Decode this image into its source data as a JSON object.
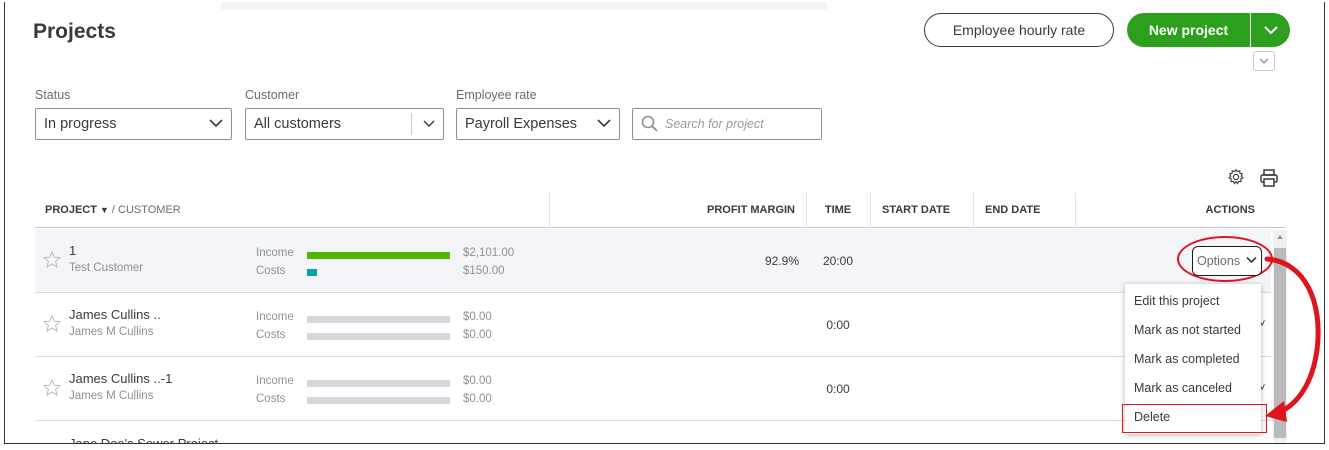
{
  "header": {
    "title": "Projects",
    "employee_rate_button": "Employee hourly rate",
    "new_project_button": "New project"
  },
  "filters": {
    "status": {
      "label": "Status",
      "value": "In progress"
    },
    "customer": {
      "label": "Customer",
      "value": "All customers"
    },
    "employee_rate": {
      "label": "Employee rate",
      "value": "Payroll Expenses"
    },
    "search": {
      "placeholder": "Search for project"
    }
  },
  "table": {
    "columns": {
      "project": "PROJECT",
      "customer": "/ CUSTOMER",
      "profit_margin": "PROFIT MARGIN",
      "time": "TIME",
      "start_date": "START DATE",
      "end_date": "END DATE",
      "actions": "ACTIONS"
    },
    "rows": [
      {
        "name": "1",
        "customer": "Test Customer",
        "income_label": "Income",
        "income": "$2,101.00",
        "income_fill": 1.0,
        "costs_label": "Costs",
        "costs": "$150.00",
        "costs_fill": 0.071,
        "profit_margin": "92.9%",
        "time": "20:00"
      },
      {
        "name": "James Cullins ..",
        "customer": "James M Cullins",
        "income_label": "Income",
        "income": "$0.00",
        "income_fill": 0,
        "costs_label": "Costs",
        "costs": "$0.00",
        "costs_fill": 0,
        "profit_margin": "",
        "time": "0:00"
      },
      {
        "name": "James Cullins ..-1",
        "customer": "James M Cullins",
        "income_label": "Income",
        "income": "$0.00",
        "income_fill": 0,
        "costs_label": "Costs",
        "costs": "$0.00",
        "costs_fill": 0,
        "profit_margin": "",
        "time": "0:00"
      }
    ],
    "partial_row": {
      "name": "Jane Doe's Sewer Project"
    }
  },
  "actions": {
    "options_button": "Options",
    "menu": [
      "Edit this project",
      "Mark as not started",
      "Mark as completed",
      "Mark as canceled",
      "Delete"
    ]
  },
  "colors": {
    "brand_green": "#2ca01c",
    "income_bar": "#53b700",
    "costs_bar": "#00a6a4",
    "annotation_red": "#e0141b"
  }
}
